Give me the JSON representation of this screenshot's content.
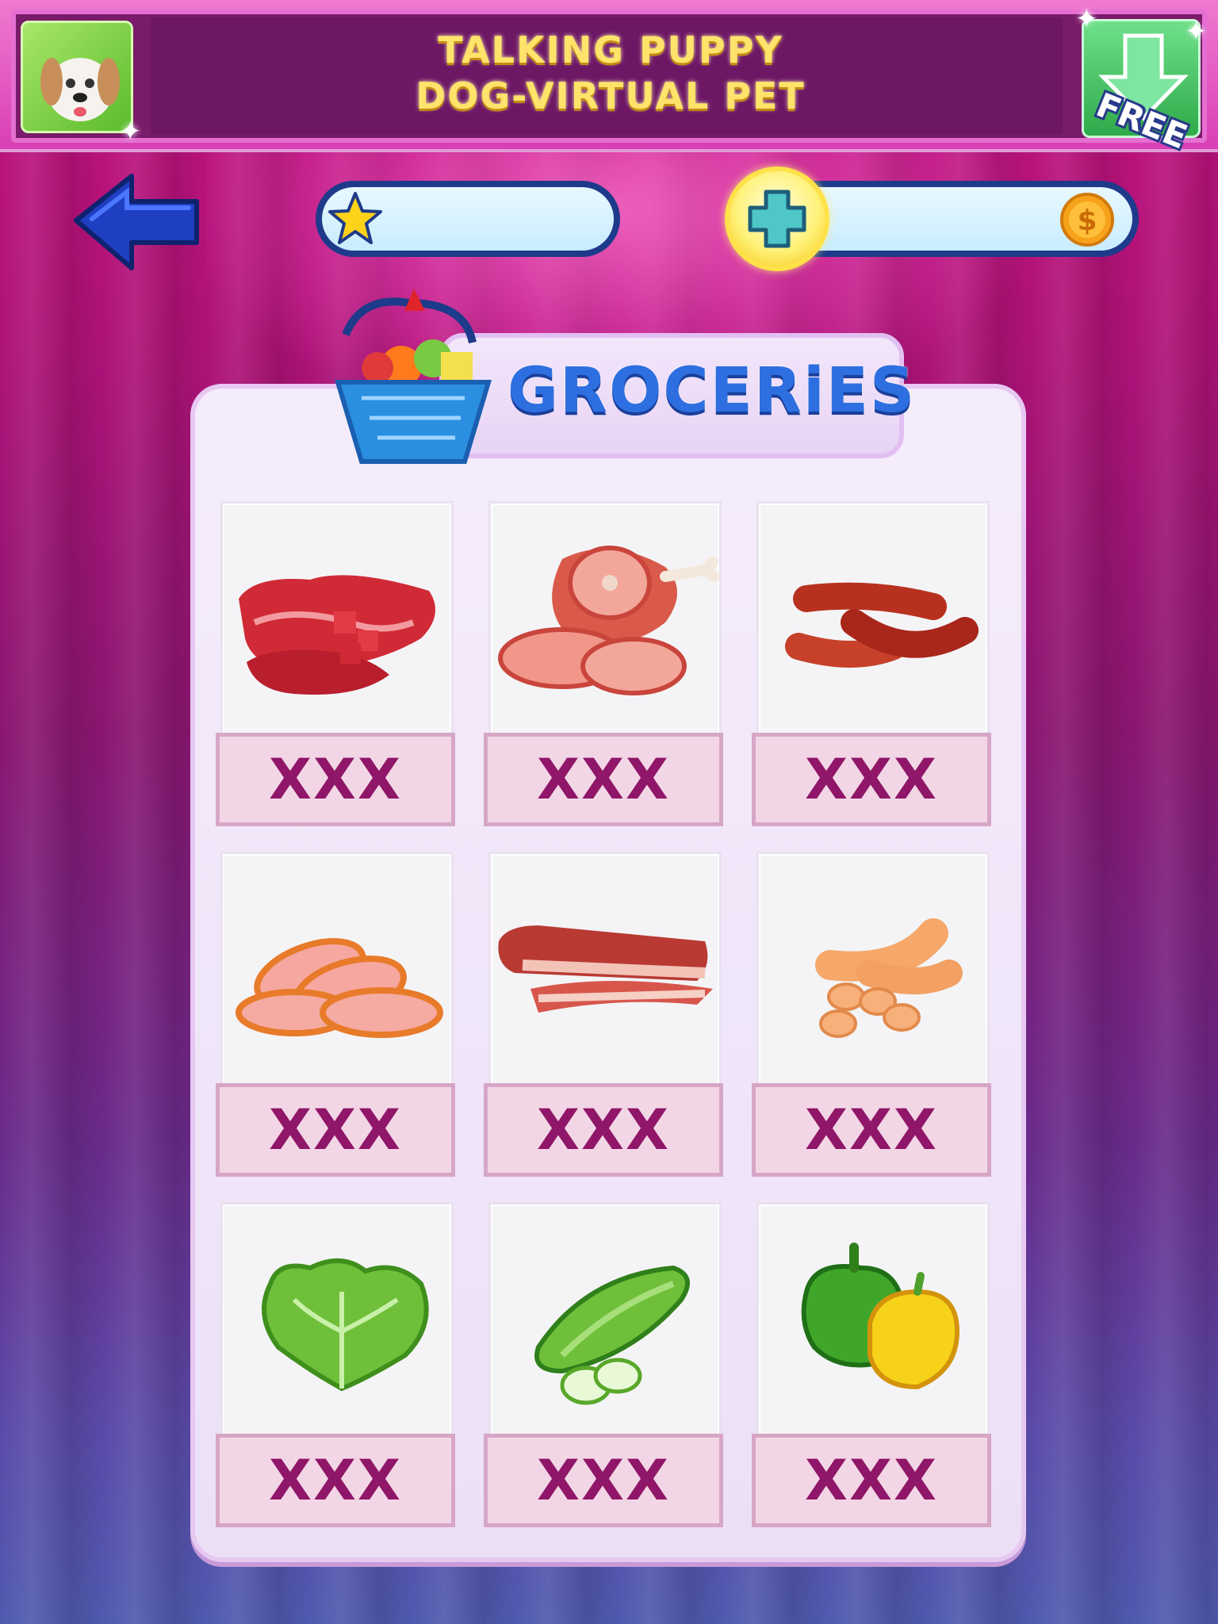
{
  "banner": {
    "title": "TALKING PUPPY\nDOG-VIRTUAL PET",
    "free_label": "FREE",
    "app_icon": "puppy-icon",
    "download_icon": "download-arrow-icon"
  },
  "status": {
    "stars_value": "",
    "coins_value": "",
    "back_icon": "back-arrow-icon",
    "star_icon": "star-icon",
    "plus_icon": "plus-icon",
    "coin_icon": "dollar-coin-icon"
  },
  "shop": {
    "title": "GROCERiES",
    "basket_icon": "grocery-basket-icon",
    "items": [
      {
        "icon": "beef-steak-icon",
        "price": "XXX"
      },
      {
        "icon": "ham-icon",
        "price": "XXX"
      },
      {
        "icon": "sausages-icon",
        "price": "XXX"
      },
      {
        "icon": "salami-slices-icon",
        "price": "XXX"
      },
      {
        "icon": "bacon-icon",
        "price": "XXX"
      },
      {
        "icon": "hot-dog-sausage-icon",
        "price": "XXX"
      },
      {
        "icon": "lettuce-icon",
        "price": "XXX"
      },
      {
        "icon": "cucumber-icon",
        "price": "XXX"
      },
      {
        "icon": "bell-peppers-icon",
        "price": "XXX"
      }
    ]
  },
  "colors": {
    "price_text": "#8f1668",
    "title_blue": "#2d6fe0",
    "banner_text": "#ffe36a"
  }
}
